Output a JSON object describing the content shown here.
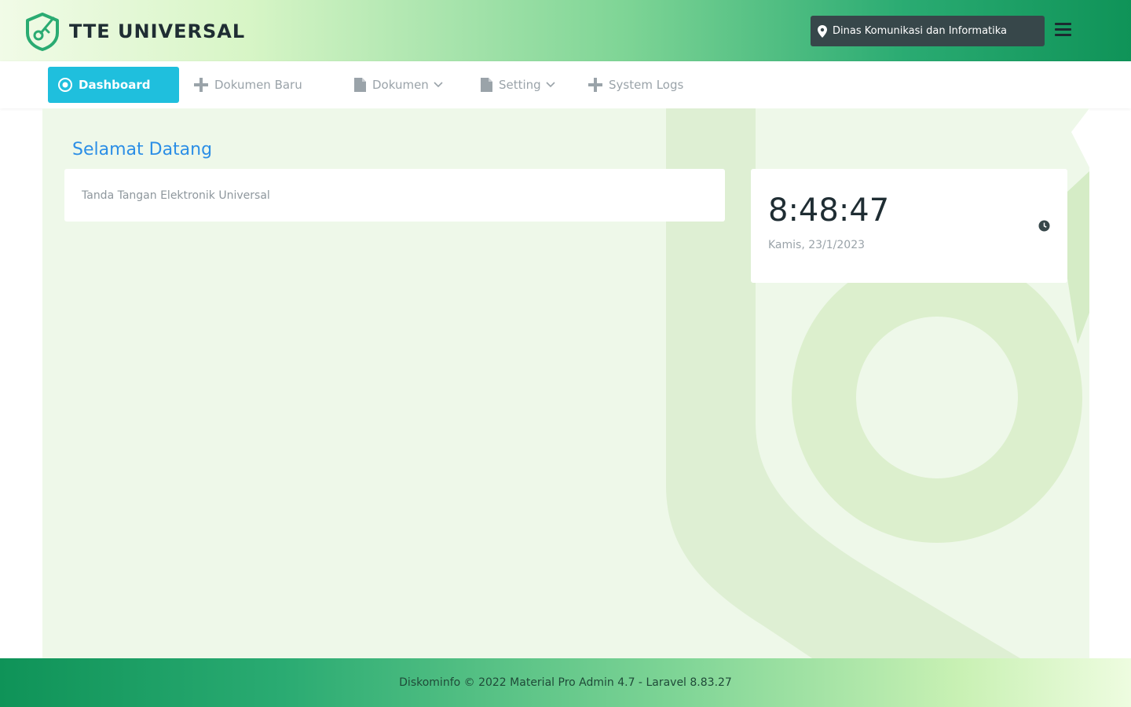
{
  "header": {
    "brand": "TTE UNIVERSAL",
    "organization": "Dinas Komunikasi dan Informatika"
  },
  "nav": {
    "items": [
      {
        "label": "Dashboard",
        "icon": "dashboard-icon",
        "active": true
      },
      {
        "label": "Dokumen Baru",
        "icon": "plus-icon"
      },
      {
        "label": "Dokumen",
        "icon": "document-icon",
        "dropdown": true
      },
      {
        "label": "Setting",
        "icon": "document-icon",
        "dropdown": true
      },
      {
        "label": "System Logs",
        "icon": "plus-icon"
      }
    ]
  },
  "main": {
    "title": "Selamat Datang",
    "welcome_text": "Tanda Tangan Elektronik Universal",
    "clock": {
      "time": "8:48:47",
      "date": "Kamis, 23/1/2023"
    }
  },
  "footer": {
    "text": "Diskominfo © 2022 Material Pro Admin 4.7 - Laravel 8.83.27"
  },
  "colors": {
    "accent": "#1fbfdd",
    "title": "#2b8ee6",
    "header_dark": "#0f9358",
    "badge": "#37474a"
  }
}
